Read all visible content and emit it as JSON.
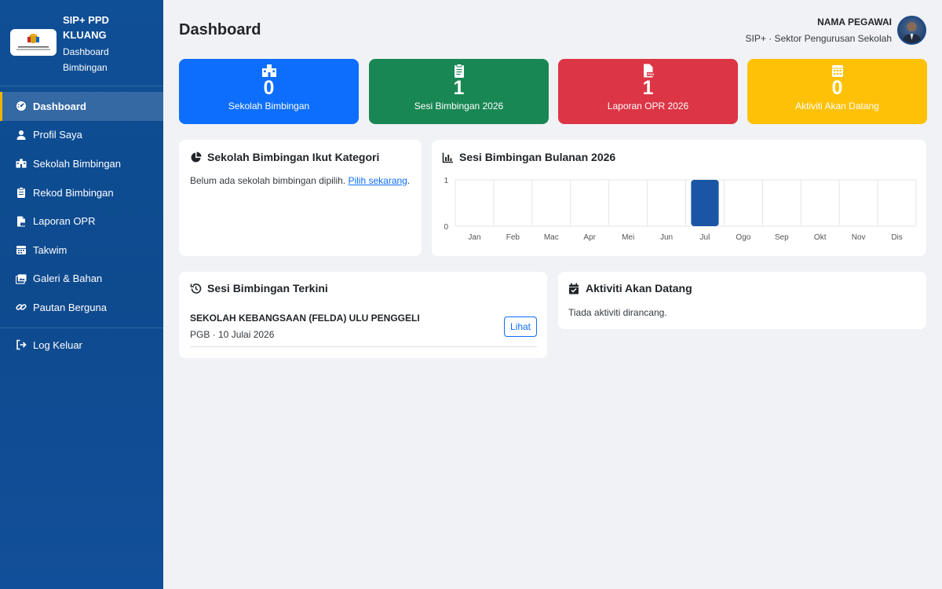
{
  "brand": {
    "title_line1": "SIP+ PPD",
    "title_line2": "KLUANG",
    "subtitle_line1": "Dashboard",
    "subtitle_line2": "Bimbingan"
  },
  "sidebar": {
    "items": [
      {
        "label": "Dashboard",
        "icon": "gauge-icon",
        "active": true
      },
      {
        "label": "Profil Saya",
        "icon": "user-icon"
      },
      {
        "label": "Sekolah Bimbingan",
        "icon": "school-icon"
      },
      {
        "label": "Rekod Bimbingan",
        "icon": "clipboard-icon"
      },
      {
        "label": "Laporan OPR",
        "icon": "file-image-icon"
      },
      {
        "label": "Takwim",
        "icon": "calendar-icon"
      },
      {
        "label": "Galeri & Bahan",
        "icon": "images-icon"
      },
      {
        "label": "Pautan Berguna",
        "icon": "link-icon"
      }
    ],
    "logout": {
      "label": "Log Keluar",
      "icon": "sign-out-icon"
    }
  },
  "header": {
    "title": "Dashboard",
    "user_name": "NAMA PEGAWAI",
    "user_role": "SIP+ · Sektor Pengurusan Sekolah"
  },
  "stats": [
    {
      "value": "0",
      "label": "Sekolah Bimbingan",
      "color": "#0d6efd",
      "icon": "school-icon"
    },
    {
      "value": "1",
      "label": "Sesi Bimbingan 2026",
      "color": "#198754",
      "icon": "clipboard-icon"
    },
    {
      "value": "1",
      "label": "Laporan OPR 2026",
      "color": "#dc3545",
      "icon": "file-png-icon"
    },
    {
      "value": "0",
      "label": "Aktiviti Akan Datang",
      "color": "#ffc107",
      "icon": "calendar-icon"
    }
  ],
  "kategori": {
    "title": "Sekolah Bimbingan Ikut Kategori",
    "empty_text": "Belum ada sekolah bimbingan dipilih.",
    "link_text": "Pilih sekarang",
    "trailing": "."
  },
  "bulanan": {
    "title": "Sesi Bimbingan Bulanan 2026"
  },
  "chart_data": {
    "type": "bar",
    "title": "Sesi Bimbingan Bulanan 2026",
    "categories": [
      "Jan",
      "Feb",
      "Mac",
      "Apr",
      "Mei",
      "Jun",
      "Jul",
      "Ogo",
      "Sep",
      "Okt",
      "Nov",
      "Dis"
    ],
    "values": [
      0,
      0,
      0,
      0,
      0,
      0,
      1,
      0,
      0,
      0,
      0,
      0
    ],
    "ylim": [
      0,
      1
    ],
    "yticks": [
      "0",
      "1"
    ],
    "bar_color": "#1a56a5",
    "grid": true
  },
  "terkini": {
    "title": "Sesi Bimbingan Terkini",
    "items": [
      {
        "school": "SEKOLAH KEBANGSAAN (FELDA) ULU PENGGELI",
        "meta": "PGB · 10 Julai 2026",
        "button": "Lihat"
      }
    ]
  },
  "aktiviti": {
    "title": "Aktiviti Akan Datang",
    "empty_text": "Tiada aktiviti dirancang."
  }
}
